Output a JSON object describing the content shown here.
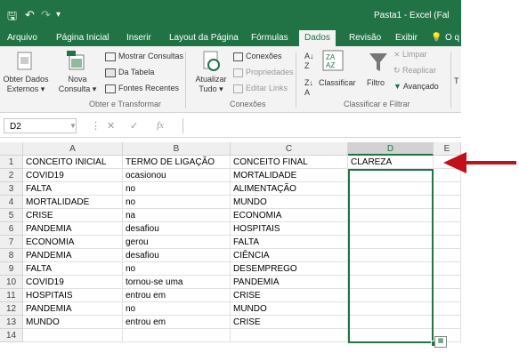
{
  "window": {
    "title": "Pasta1 - Excel (Fal"
  },
  "quick_access": {
    "save_icon": "save-icon",
    "undo_icon": "undo-icon",
    "redo_icon": "redo-icon"
  },
  "tabs": [
    "Arquivo",
    "Página Inicial",
    "Inserir",
    "Layout da Página",
    "Fórmulas",
    "Dados",
    "Revisão",
    "Exibir"
  ],
  "active_tab": "Dados",
  "tell_me": "O q",
  "ribbon": {
    "obter_dados": "Obter Dados",
    "externos": "Externos ▾",
    "nova": "Nova",
    "consulta": "Consulta ▾",
    "mostrar_consultas": "Mostrar Consultas",
    "da_tabela": "Da Tabela",
    "fontes_recentes": "Fontes Recentes",
    "group1": "Obter e Transformar",
    "atualizar": "Atualizar",
    "tudo": "Tudo ▾",
    "conexoes": "Conexões",
    "propriedades": "Propriedades",
    "editar_links": "Editar Links",
    "group2": "Conexões",
    "classificar": "Classificar",
    "filtro": "Filtro",
    "limpar": "Limpar",
    "reaplicar": "Reaplicar",
    "avancado": "Avançado",
    "group3": "Classificar e Filtrar",
    "t_cut": "T"
  },
  "formula_bar": {
    "name_box": "D2",
    "fx": "fx",
    "value": ""
  },
  "columns": [
    "A",
    "B",
    "C",
    "D",
    "E"
  ],
  "rows": [
    [
      "CONCEITO INICIAL",
      "TERMO DE LIGAÇÃO",
      "CONCEITO FINAL",
      "CLAREZA",
      ""
    ],
    [
      "COVID19",
      "ocasionou",
      "MORTALIDADE",
      "",
      ""
    ],
    [
      "FALTA",
      "no",
      "ALIMENTAÇÃO",
      "",
      ""
    ],
    [
      "MORTALIDADE",
      "no",
      "MUNDO",
      "",
      ""
    ],
    [
      "CRISE",
      "na",
      "ECONOMIA",
      "",
      ""
    ],
    [
      "PANDEMIA",
      "desafiou",
      "HOSPITAIS",
      "",
      ""
    ],
    [
      "ECONOMIA",
      "gerou",
      "FALTA",
      "",
      ""
    ],
    [
      "PANDEMIA",
      "desafiou",
      "CIÊNCIA",
      "",
      ""
    ],
    [
      "FALTA",
      "no",
      "DESEMPREGO",
      "",
      ""
    ],
    [
      "COVID19",
      "tornou-se uma",
      "PANDEMIA",
      "",
      ""
    ],
    [
      "HOSPITAIS",
      "entrou em",
      "CRISE",
      "",
      ""
    ],
    [
      "PANDEMIA",
      "no",
      "MUNDO",
      "",
      ""
    ],
    [
      "MUNDO",
      "entrou em",
      "CRISE",
      "",
      ""
    ],
    [
      "",
      "",
      "",
      "",
      ""
    ]
  ],
  "row_numbers": [
    "1",
    "2",
    "3",
    "4",
    "5",
    "6",
    "7",
    "8",
    "9",
    "10",
    "11",
    "12",
    "13",
    "14"
  ],
  "accent": "#217346",
  "arrow_color": "#c0101a"
}
